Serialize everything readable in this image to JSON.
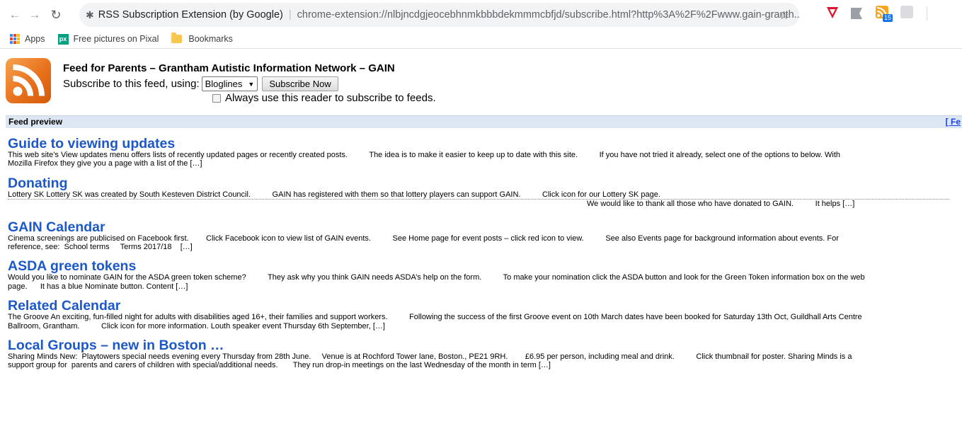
{
  "browser": {
    "tab_title": "RSS Subscription Extension (by Google)",
    "url": "chrome-extension://nlbjncdgjeocebhnmkbbbdekmmmcbfjd/subscribe.html?http%3A%2F%2Fwww.gain-granth...",
    "rss_badge_count": "15"
  },
  "bookmarks": {
    "apps": "Apps",
    "pixabay": "Free pictures on Pixal",
    "pixabay_icon": "px",
    "bookmarks": "Bookmarks"
  },
  "header": {
    "feed_title": "Feed for Parents – Grantham Autistic Information Network – GAIN",
    "subscribe_label": "Subscribe to this feed, using:",
    "reader_selected": "Bloglines",
    "subscribe_button": "Subscribe Now",
    "always_use": "Always use this reader to subscribe to feeds."
  },
  "preview": {
    "label": "Feed preview",
    "right_link": "[ Fe"
  },
  "entries": [
    {
      "title": "Guide to viewing updates",
      "body": "This web site’s View updates menu offers lists of recently updated pages or recently created posts.          The idea is to make it easier to keep up to date with this site.          If you have not tried it already, select one of the options to below. With\nMozilla Firefox they give you a page with a list of the […]"
    },
    {
      "title": "Donating",
      "body1": "Lottery SK Lottery SK was created by South Kesteven District Council.          GAIN has registered with them so that lottery players can support GAIN.          Click icon for our Lottery SK page.",
      "body2": "We would like to thank all those who have donated to GAIN.          It helps […]"
    },
    {
      "title": "GAIN Calendar",
      "body": "Cinema screenings are publicised on Facebook first.        Click Facebook icon to view list of GAIN events.          See Home page for event posts – click red icon to view.          See also Events page for background information about events. For\nreference, see:  School terms     Terms 2017/18    […]"
    },
    {
      "title": "ASDA green tokens",
      "body": "Would you like to nominate GAIN for the ASDA green token scheme?          They ask why you think GAIN needs ASDA’s help on the form.          To make your nomination click the ASDA button and look for the Green Token information box on the web\npage.      It has a blue Nominate button. Content […]"
    },
    {
      "title": "Related Calendar",
      "body": "The Groove An exciting, fun-filled night for adults with disabilities aged 16+, their families and support workers.          Following the success of the first Groove event on 10th March dates have been booked for Saturday 13th Oct, Guildhall Arts Centre\nBallroom, Grantham.          Click icon for more information. Louth speaker event Thursday 6th September, […]"
    },
    {
      "title": "Local Groups – new in Boston …",
      "body": "Sharing Minds New:  Playtowers special needs evening every Thursday from 28th June.     Venue is at Rochford Tower lane, Boston., PE21 9RH.        £6.95 per person, including meal and drink.          Click thumbnail for poster. Sharing Minds is a\nsupport group for  parents and carers of children with special/additional needs.       They run drop-in meetings on the last Wednesday of the month in term […]"
    }
  ]
}
